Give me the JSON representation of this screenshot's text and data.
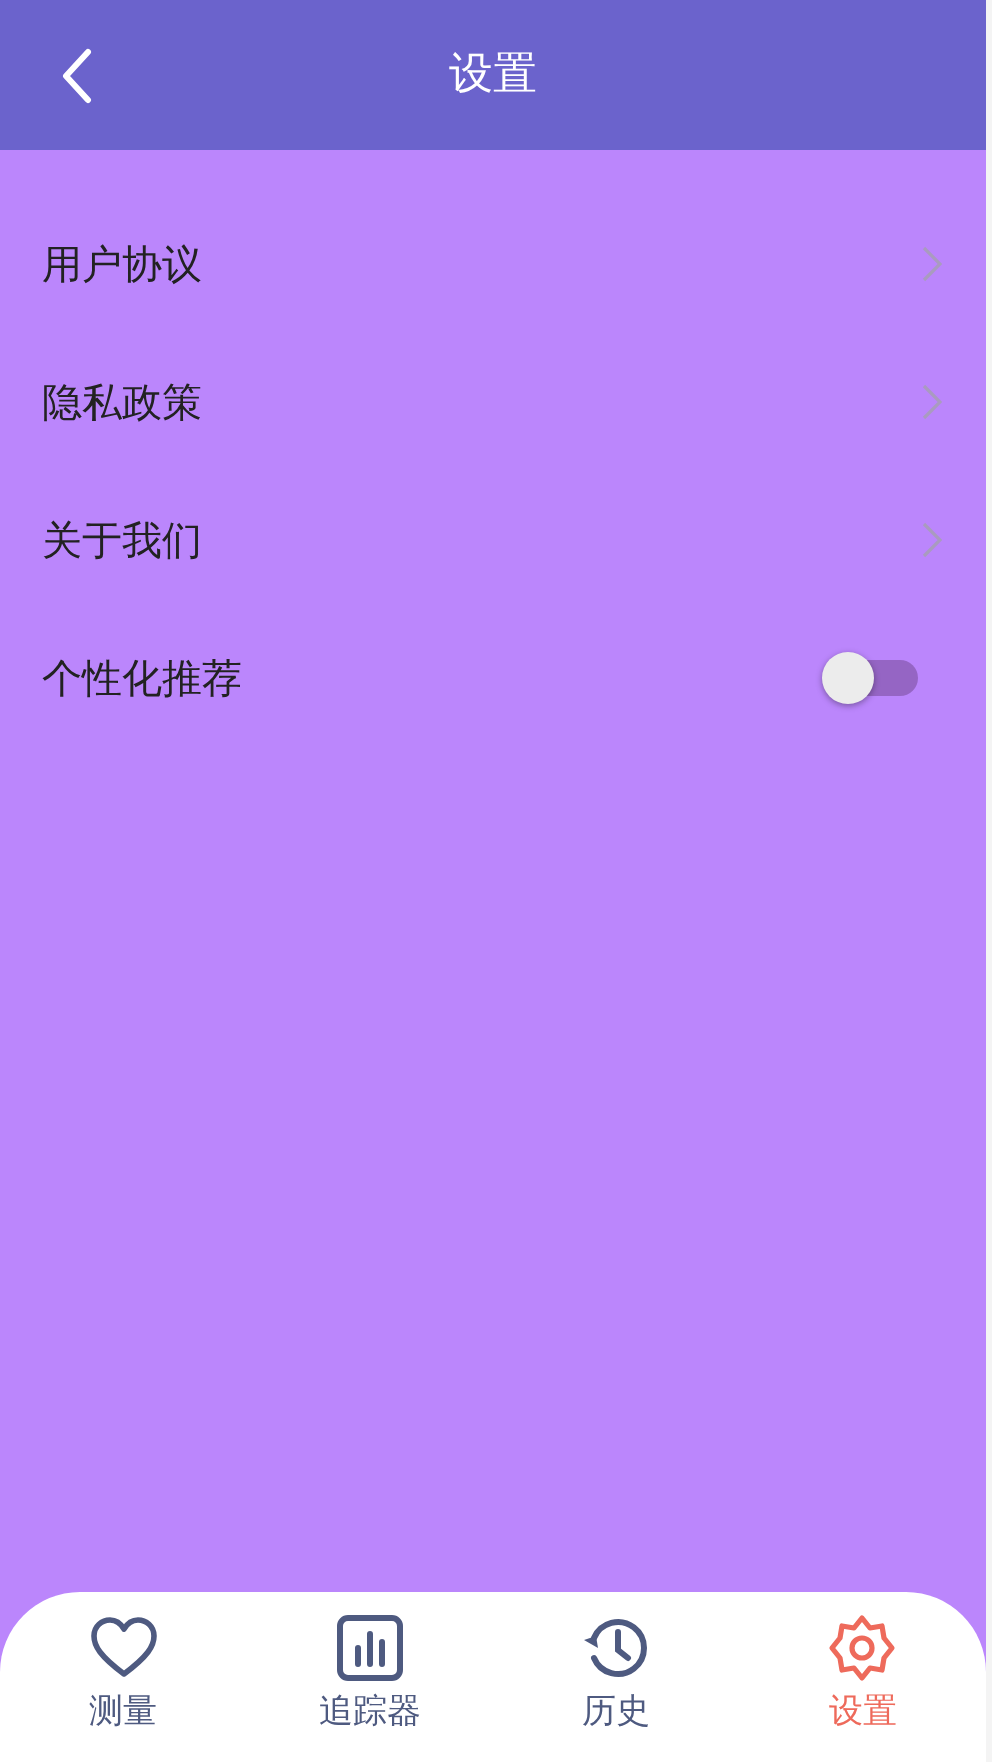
{
  "header": {
    "title": "设置"
  },
  "items": [
    {
      "kind": "link",
      "label": "用户协议"
    },
    {
      "kind": "link",
      "label": "隐私政策"
    },
    {
      "kind": "link",
      "label": "关于我们"
    },
    {
      "kind": "toggle",
      "label": "个性化推荐",
      "on": false
    }
  ],
  "tabs": [
    {
      "label": "测量",
      "selected": false
    },
    {
      "label": "追踪器",
      "selected": false
    },
    {
      "label": "历史",
      "selected": false
    },
    {
      "label": "设置",
      "selected": true
    }
  ]
}
